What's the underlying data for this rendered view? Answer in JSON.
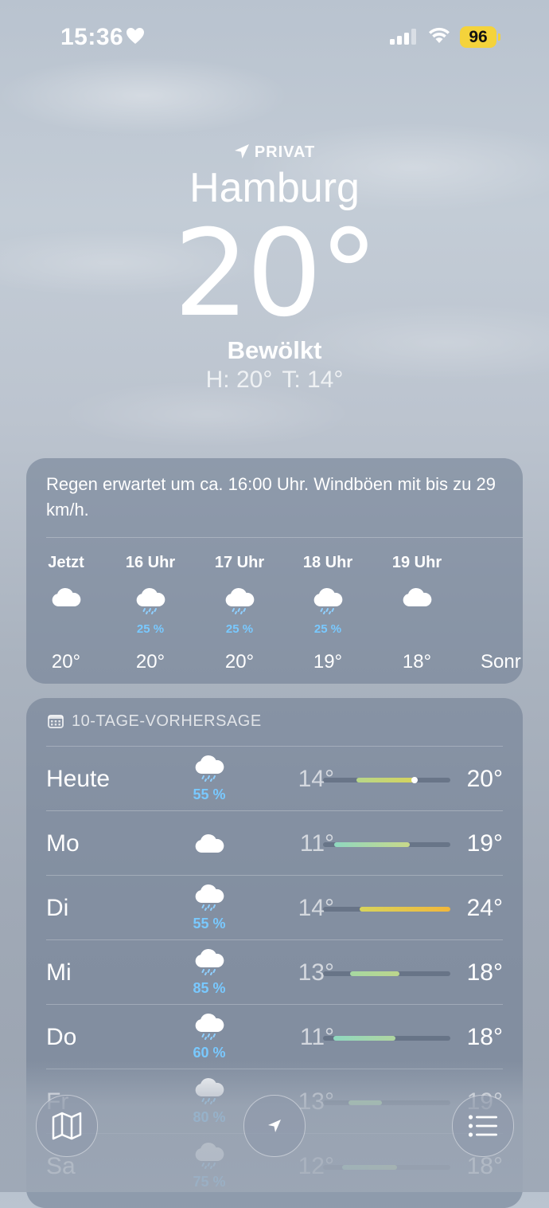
{
  "status_bar": {
    "time": "15:36",
    "battery": "96"
  },
  "header": {
    "location_label": "PRIVAT",
    "city": "Hamburg",
    "temperature": "20",
    "degree": "°",
    "condition": "Bewölkt",
    "high": "H: 20°",
    "low": "T: 14°"
  },
  "hourly": {
    "summary": "Regen erwartet um ca. 16:00 Uhr. Windböen mit bis zu 29 km/h.",
    "items": [
      {
        "label": "Jetzt",
        "icon": "cloud-icon",
        "precip": "",
        "temp": "20°"
      },
      {
        "label": "16 Uhr",
        "icon": "cloud-rain-icon",
        "precip": "25 %",
        "temp": "20°"
      },
      {
        "label": "17 Uhr",
        "icon": "cloud-rain-icon",
        "precip": "25 %",
        "temp": "20°"
      },
      {
        "label": "18 Uhr",
        "icon": "cloud-rain-icon",
        "precip": "25 %",
        "temp": "19°"
      },
      {
        "label": "19 Uhr",
        "icon": "cloud-icon",
        "precip": "",
        "temp": "18°"
      },
      {
        "label": "",
        "icon": "",
        "precip": "",
        "temp": "Sonr"
      }
    ]
  },
  "daily": {
    "title": "10-TAGE-VORHERSAGE",
    "days": [
      {
        "day": "Heute",
        "icon": "cloud-rain-icon",
        "precip": "55 %",
        "low": "14°",
        "high": "20°",
        "range": [
          0.26,
          0.72
        ],
        "current": 0.72,
        "color_from": "#b7d68a",
        "color_to": "#d6d45c"
      },
      {
        "day": "Mo",
        "icon": "cloud-icon",
        "precip": "",
        "low": "11°",
        "high": "19°",
        "range": [
          0.09,
          0.68
        ],
        "color_from": "#8fd8c0",
        "color_to": "#c9d98a"
      },
      {
        "day": "Di",
        "icon": "cloud-rain-icon",
        "precip": "55 %",
        "low": "14°",
        "high": "24°",
        "range": [
          0.29,
          1.0
        ],
        "color_from": "#d7d45c",
        "color_to": "#f2b73a"
      },
      {
        "day": "Mi",
        "icon": "cloud-rain-icon",
        "precip": "85 %",
        "low": "13°",
        "high": "18°",
        "range": [
          0.21,
          0.6
        ],
        "color_from": "#a6d8a2",
        "color_to": "#bcd68c"
      },
      {
        "day": "Do",
        "icon": "cloud-rain-icon",
        "precip": "60 %",
        "low": "11°",
        "high": "18°",
        "range": [
          0.08,
          0.57
        ],
        "color_from": "#8fd8c0",
        "color_to": "#b0d6a0"
      },
      {
        "day": "Fr",
        "icon": "cloud-rain-icon",
        "precip": "80 %",
        "low": "13°",
        "high": "19°",
        "range": [
          0.2,
          0.46
        ],
        "color_from": "#a6d8a2",
        "color_to": "#a6d8a2"
      },
      {
        "day": "Sa",
        "icon": "cloud-rain-icon",
        "precip": "75 %",
        "low": "12°",
        "high": "18°",
        "range": [
          0.15,
          0.58
        ],
        "color_from": "#9bd3b4",
        "color_to": "#b6d698"
      }
    ]
  },
  "bottom_bar": {
    "map_icon": "map-icon",
    "location_icon": "location-arrow-icon",
    "list_icon": "list-icon"
  }
}
